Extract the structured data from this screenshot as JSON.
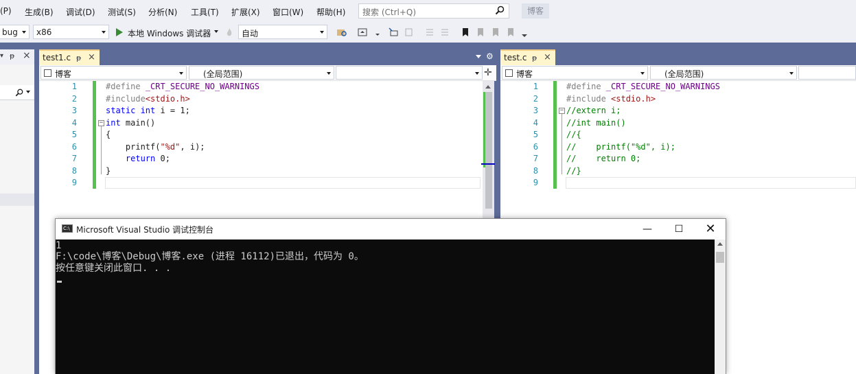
{
  "menu": [
    "(P)",
    "生成(B)",
    "调试(D)",
    "测试(S)",
    "分析(N)",
    "工具(T)",
    "扩展(X)",
    "窗口(W)",
    "帮助(H)"
  ],
  "search": {
    "placeholder": "搜索 (Ctrl+Q)"
  },
  "project_badge": "博客",
  "toolbar": {
    "config": "bug",
    "platform": "x86",
    "run_label": "本地 Windows 调试器",
    "mode": "自动"
  },
  "left_panel": {
    "pin": "ᵽ",
    "close": "×"
  },
  "editor1": {
    "tab": "test1.c",
    "scope_project": "博客",
    "scope_global": "(全局范围)",
    "lines": [
      "1",
      "2",
      "3",
      "4",
      "5",
      "6",
      "7",
      "8",
      "9"
    ]
  },
  "editor2": {
    "tab": "test.c",
    "scope_project": "博客",
    "scope_global": "(全局范围)",
    "lines": [
      "1",
      "2",
      "3",
      "4",
      "5",
      "6",
      "7",
      "8",
      "9"
    ]
  },
  "console": {
    "title": "Microsoft Visual Studio 调试控制台",
    "lines": [
      "1",
      "F:\\code\\博客\\Debug\\博客.exe (进程 16112)已退出，代码为 0。",
      "按任意键关闭此窗口. . ."
    ]
  }
}
